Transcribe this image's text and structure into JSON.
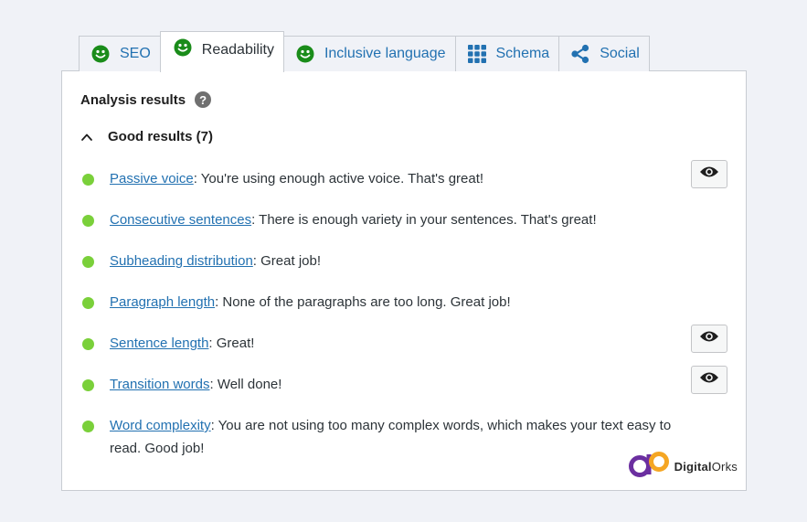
{
  "tabs": [
    {
      "label": "SEO",
      "icon": "smiley-icon",
      "active": false
    },
    {
      "label": "Readability",
      "icon": "smiley-icon",
      "active": true
    },
    {
      "label": "Inclusive language",
      "icon": "smiley-icon",
      "active": false
    },
    {
      "label": "Schema",
      "icon": "grid-icon",
      "active": false
    },
    {
      "label": "Social",
      "icon": "share-icon",
      "active": false
    }
  ],
  "panel": {
    "heading": "Analysis results",
    "help_symbol": "?",
    "group_label": "Good results (7)"
  },
  "results": [
    {
      "link": "Passive voice",
      "text": ": You're using enough active voice. That's great!",
      "has_eye": true
    },
    {
      "link": "Consecutive sentences",
      "text": ": There is enough variety in your sentences. That's great!",
      "has_eye": false
    },
    {
      "link": "Subheading distribution",
      "text": ": Great job!",
      "has_eye": false
    },
    {
      "link": "Paragraph length",
      "text": ": None of the paragraphs are too long. Great job!",
      "has_eye": false
    },
    {
      "link": "Sentence length",
      "text": ": Great!",
      "has_eye": true
    },
    {
      "link": "Transition words",
      "text": ": Well done!",
      "has_eye": true
    },
    {
      "link": "Word complexity",
      "text": ": You are not using too many complex words, which makes your text easy to read. Good job!",
      "has_eye": false
    }
  ],
  "watermark": {
    "part1": "Digital",
    "part2": "Orks"
  },
  "colors": {
    "good": "#7ad03a",
    "smiley": "#1a8c1a",
    "link": "#2271b1",
    "logo_purple": "#6b2fa0",
    "logo_orange": "#f5a623"
  }
}
